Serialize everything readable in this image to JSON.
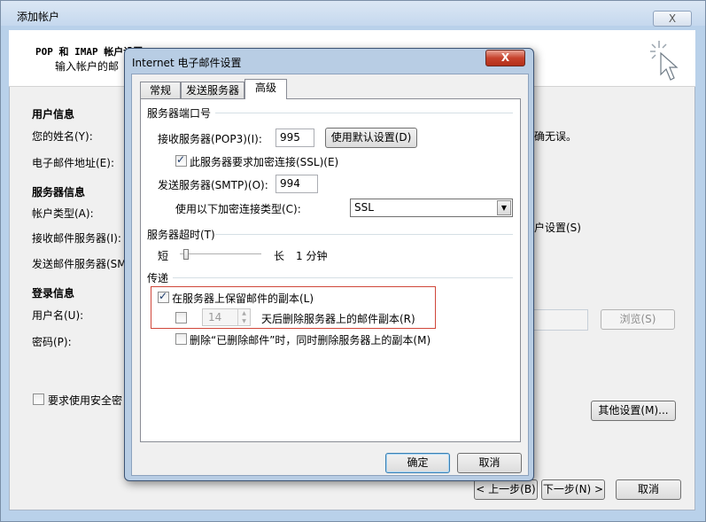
{
  "outer_window": {
    "title": "添加帐户",
    "close_label": "X",
    "header_title": "POP 和 IMAP 帐户设置",
    "header_subtitle": "输入帐户的邮",
    "sections": {
      "user_info": "用户信息",
      "server_info": "服务器信息",
      "login_info": "登录信息"
    },
    "labels": {
      "name": "您的姓名(Y):",
      "email": "电子邮件地址(E):",
      "account_type": "帐户类型(A):",
      "incoming": "接收邮件服务器(I):",
      "outgoing": "发送邮件服务器(SM",
      "username": "用户名(U):",
      "password": "密码(P):",
      "spa": "要求使用安全密",
      "right_text1": "确无误。",
      "right_text2": "户设置(S)"
    },
    "buttons": {
      "browse": "浏览(S)",
      "more_settings": "其他设置(M)...",
      "back": "< 上一步(B)",
      "next": "下一步(N) >",
      "cancel": "取消"
    }
  },
  "dialog": {
    "title": "Internet 电子邮件设置",
    "close_label": "X",
    "tabs": [
      "常规",
      "发送服务器",
      "高级"
    ],
    "active_tab": "高级",
    "ports_group": "服务器端口号",
    "incoming_label": "接收服务器(POP3)(I):",
    "incoming_port": "995",
    "use_default_button": "使用默认设置(D)",
    "ssl_checkbox_label": "此服务器要求加密连接(SSL)(E)",
    "ssl_checked": true,
    "outgoing_label": "发送服务器(SMTP)(O):",
    "outgoing_port": "994",
    "encryption_label": "使用以下加密连接类型(C):",
    "encryption_value": "SSL",
    "timeout_group": "服务器超时(T)",
    "timeout_short": "短",
    "timeout_long": "长",
    "timeout_value": "1 分钟",
    "delivery_group": "传递",
    "leave_copy_label": "在服务器上保留邮件的副本(L)",
    "leave_copy_checked": true,
    "remove_after_days": "14",
    "remove_after_label": "天后删除服务器上的邮件副本(R)",
    "remove_after_checked": false,
    "remove_deleted_label": "删除“已删除邮件”时，同时删除服务器上的副本(M)",
    "remove_deleted_checked": false,
    "ok_button": "确定",
    "cancel_button": "取消"
  }
}
